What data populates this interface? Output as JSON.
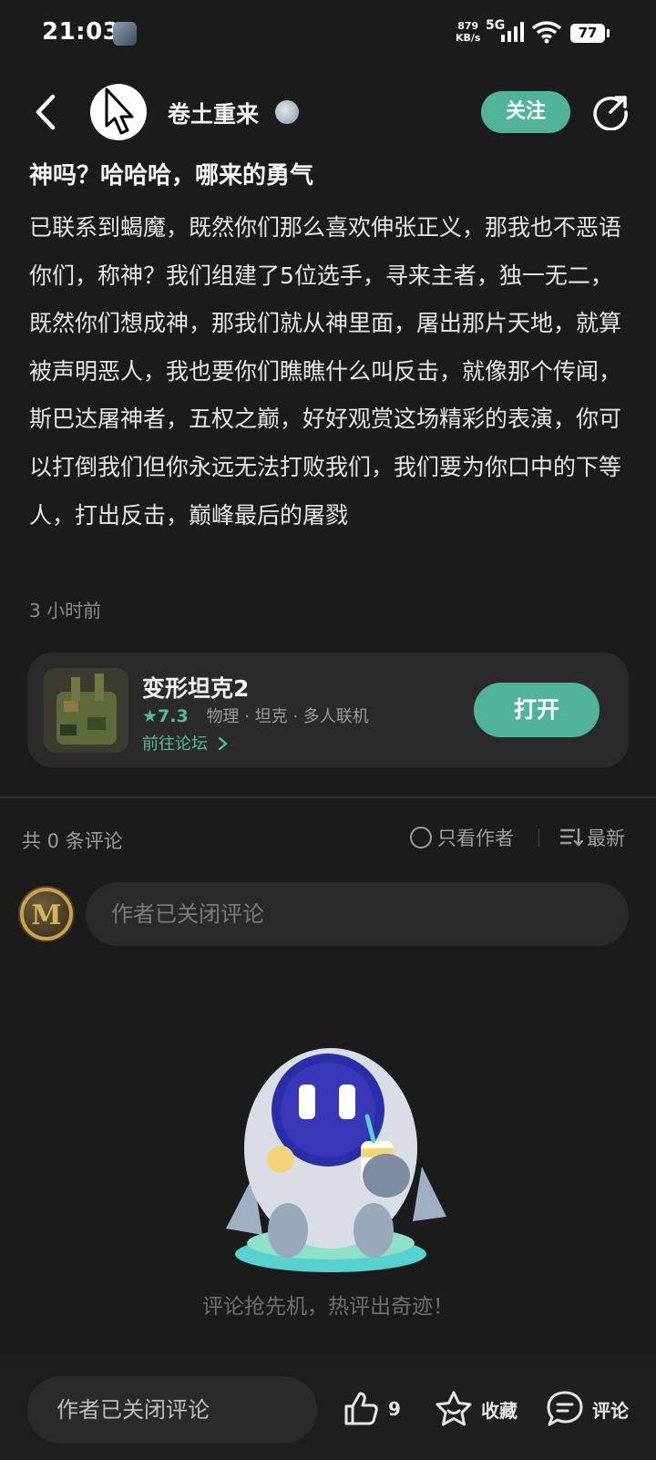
{
  "status_bar": {
    "time": "21:03",
    "net_speed_value": "879",
    "net_speed_unit": "KB/s",
    "network": "5G",
    "battery": "77"
  },
  "header": {
    "username": "卷土重来",
    "follow_label": "关注"
  },
  "post": {
    "title": "神吗？哈哈哈，哪来的勇气",
    "body": "已联系到蝎魔，既然你们那么喜欢伸张正义，那我也不恶语你们，称神？我们组建了5位选手，寻来主者，独一无二，既然你们想成神，那我们就从神里面，屠出那片天地，就算被声明恶人，我也要你们瞧瞧什么叫反击，就像那个传闻，斯巴达屠神者，五权之巅，好好观赏这场精彩的表演，你可以打倒我们但你永远无法打败我们，我们要为你口中的下等人，打出反击，巅峰最后的屠戮",
    "time": "3 小时前"
  },
  "game_card": {
    "name": "变形坦克2",
    "rating": "★7.3",
    "tags": "物理 · 坦克 · 多人联机",
    "forum_link": "前往论坛",
    "open_label": "打开",
    "accent_color": "#50b39a"
  },
  "comments": {
    "count_label": "共 0 条评论",
    "only_author_label": "只看作者",
    "sort_label": "最新",
    "input_placeholder": "作者已关闭评论",
    "empty_text": "评论抢先机，热评出奇迹！"
  },
  "bottom_bar": {
    "input_placeholder": "作者已关闭评论",
    "like_count": "9",
    "favorite_label": "收藏",
    "comment_label": "评论"
  },
  "icons": [
    "back-arrow-icon",
    "share-icon",
    "level-badge-icon",
    "chevron-right-icon",
    "radio-circle-icon",
    "sort-icon",
    "thumbs-up-icon",
    "star-icon",
    "comment-bubble-icon"
  ]
}
